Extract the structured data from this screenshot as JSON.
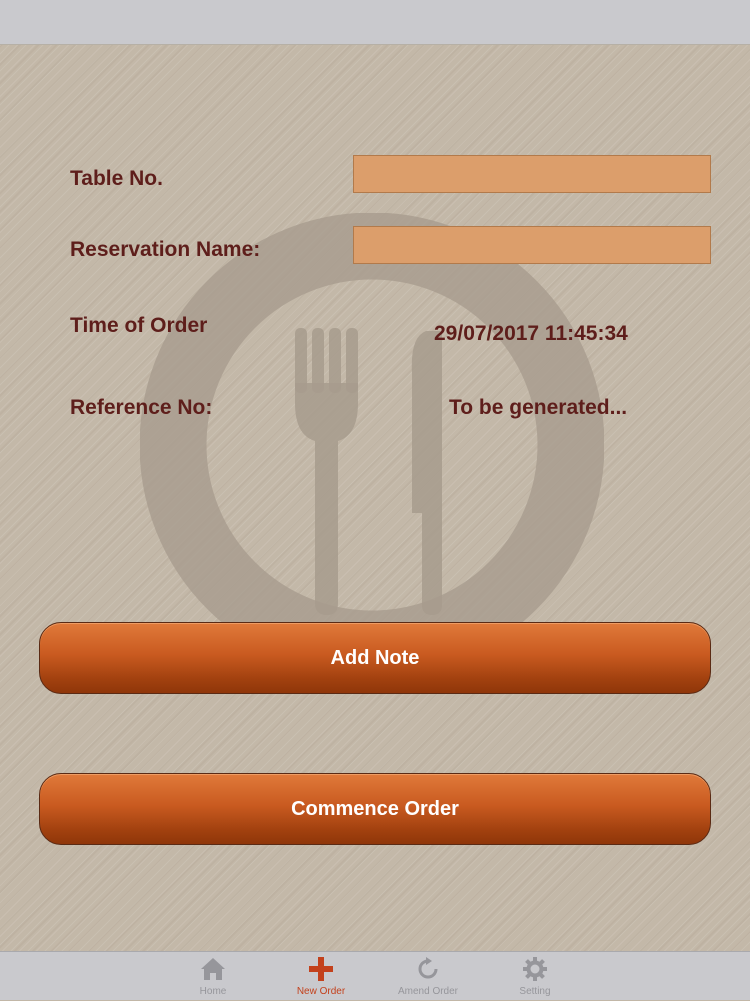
{
  "form": {
    "table_no_label": "Table No.",
    "table_no_value": "",
    "reservation_name_label": "Reservation Name:",
    "reservation_name_value": "",
    "time_of_order_label": "Time of Order",
    "time_of_order_value": "29/07/2017 11:45:34",
    "reference_no_label": "Reference No:",
    "reference_no_value": "To be generated..."
  },
  "buttons": {
    "add_note_label": "Add Note",
    "commence_order_label": "Commence Order"
  },
  "tab_bar": {
    "active_tab": "New Order",
    "tabs": [
      {
        "label": "Home",
        "icon": "home-icon"
      },
      {
        "label": "New Order",
        "icon": "plus-icon"
      },
      {
        "label": "Amend Order",
        "icon": "refresh-icon"
      },
      {
        "label": "Setting",
        "icon": "gear-icon"
      }
    ]
  },
  "background": {
    "logo_icon": "plate-fork-knife-icon"
  },
  "colors": {
    "label_text": "#5e1e1b",
    "input_fill": "#dc9e6b",
    "button_top": "#e07a3a",
    "button_bottom": "#8f3609",
    "active_tab": "#c3411c",
    "inactive_tab": "#96969b",
    "background": "#c3b8a8"
  }
}
